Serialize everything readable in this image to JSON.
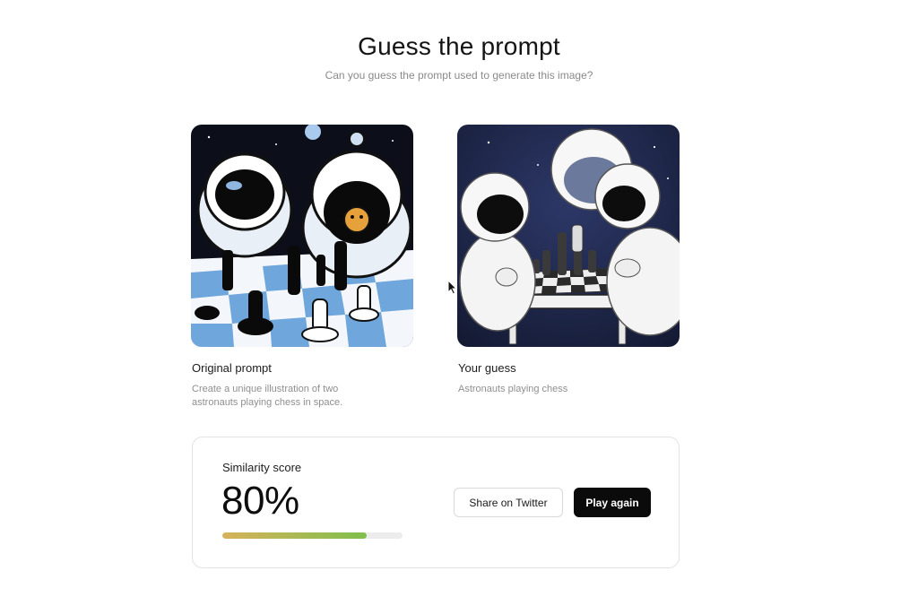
{
  "header": {
    "title": "Guess the prompt",
    "subtitle": "Can you guess the prompt used to generate this image?"
  },
  "original": {
    "heading": "Original prompt",
    "text": "Create a unique illustration of two astronauts playing chess in space."
  },
  "guess": {
    "heading": "Your guess",
    "text": "Astronauts playing chess"
  },
  "score": {
    "label": "Similarity score",
    "value": "80%",
    "fraction": 0.8
  },
  "actions": {
    "share_label": "Share on Twitter",
    "play_again_label": "Play again"
  },
  "colors": {
    "progress_start": "#d7b25a",
    "progress_end": "#7fbf4d",
    "primary_button": "#0b0b0b"
  }
}
